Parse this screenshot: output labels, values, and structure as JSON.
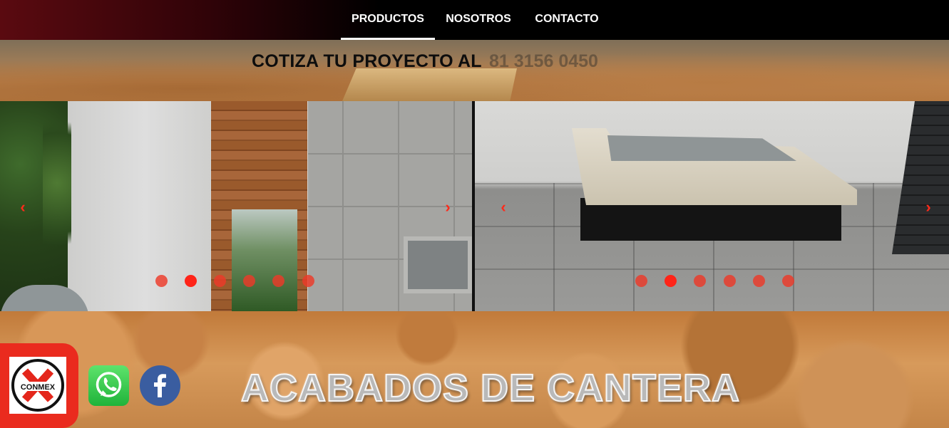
{
  "nav": {
    "items": [
      {
        "label": "PRODUCTOS",
        "active": true
      },
      {
        "label": "NOSOTROS",
        "active": false
      },
      {
        "label": "CONTACTO",
        "active": false
      }
    ]
  },
  "quote": {
    "text": "COTIZA TU PROYECTO AL",
    "phone": "81 3156 0450"
  },
  "carousels": [
    {
      "name": "left",
      "slide_count": 6,
      "active_index": 1,
      "prev_icon": "chevron-left-icon",
      "next_icon": "chevron-right-icon"
    },
    {
      "name": "right",
      "slide_count": 6,
      "active_index": 1,
      "prev_icon": "chevron-left-icon",
      "next_icon": "chevron-right-icon"
    }
  ],
  "brand": {
    "logo_text": "CONMEX"
  },
  "social": [
    {
      "name": "whatsapp-icon"
    },
    {
      "name": "facebook-icon"
    }
  ],
  "headline": "ACABADOS DE CANTERA",
  "colors": {
    "accent_red": "#ea2b1e",
    "nav_bg": "#000000",
    "nav_gradient_start": "#5a0a10"
  }
}
